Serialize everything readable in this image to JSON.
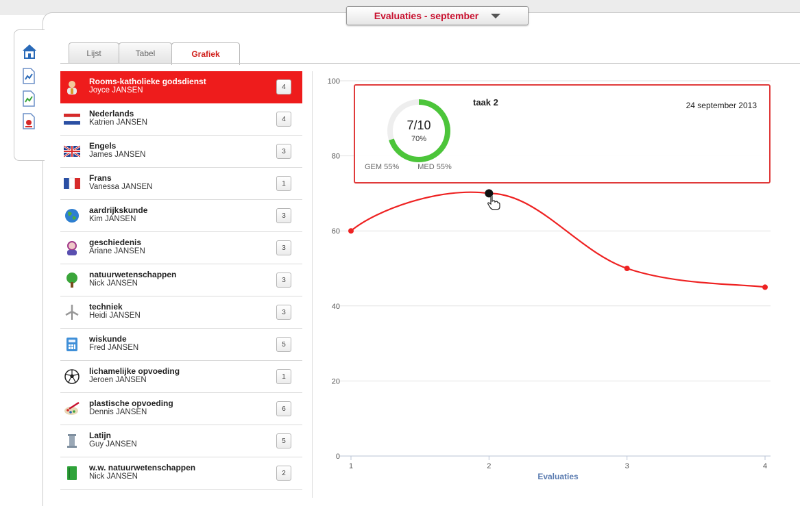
{
  "header": {
    "title": "Evaluaties - september"
  },
  "side_nav": {
    "items": [
      "home-icon",
      "document-chart-icon",
      "document-chart-green-icon",
      "document-report-icon"
    ]
  },
  "tabs": [
    {
      "label": "Lijst",
      "active": false
    },
    {
      "label": "Tabel",
      "active": false
    },
    {
      "label": "Grafiek",
      "active": true
    }
  ],
  "subjects": [
    {
      "name": "Rooms-katholieke godsdienst",
      "teacher": "Joyce JANSEN",
      "count": "4",
      "icon": "religion-icon",
      "active": true
    },
    {
      "name": "Nederlands",
      "teacher": "Katrien JANSEN",
      "count": "4",
      "icon": "dutch-flag-icon"
    },
    {
      "name": "Engels",
      "teacher": "James JANSEN",
      "count": "3",
      "icon": "uk-flag-icon"
    },
    {
      "name": "Frans",
      "teacher": "Vanessa JANSEN",
      "count": "1",
      "icon": "french-flag-icon"
    },
    {
      "name": "aardrijkskunde",
      "teacher": "Kim JANSEN",
      "count": "3",
      "icon": "globe-icon"
    },
    {
      "name": "geschiedenis",
      "teacher": "Ariane JANSEN",
      "count": "3",
      "icon": "history-icon"
    },
    {
      "name": "natuurwetenschappen",
      "teacher": "Nick JANSEN",
      "count": "3",
      "icon": "tree-icon"
    },
    {
      "name": "techniek",
      "teacher": "Heidi JANSEN",
      "count": "3",
      "icon": "windmill-icon"
    },
    {
      "name": "wiskunde",
      "teacher": "Fred JANSEN",
      "count": "5",
      "icon": "calculator-icon"
    },
    {
      "name": "lichamelijke opvoeding",
      "teacher": "Jeroen JANSEN",
      "count": "1",
      "icon": "football-icon"
    },
    {
      "name": "plastische opvoeding",
      "teacher": "Dennis JANSEN",
      "count": "6",
      "icon": "paint-icon"
    },
    {
      "name": "Latijn",
      "teacher": "Guy JANSEN",
      "count": "5",
      "icon": "column-icon"
    },
    {
      "name": "w.w. natuurwetenschappen",
      "teacher": "Nick JANSEN",
      "count": "2",
      "icon": "book-icon"
    }
  ],
  "tooltip": {
    "task": "taak 2",
    "date": "24 september 2013",
    "score": "7/10",
    "percent": "70%",
    "percent_value": 70,
    "gem": "GEM 55%",
    "med": "MED 55%"
  },
  "chart_data": {
    "type": "line",
    "x": [
      1,
      2,
      3,
      4
    ],
    "series": [
      {
        "values": [
          60,
          70,
          50,
          45
        ],
        "color": "#ee2222"
      }
    ],
    "xlabel": "Evaluaties",
    "ylabel": "",
    "ylim": [
      0,
      100
    ],
    "yticks": [
      0,
      20,
      40,
      60,
      80,
      100
    ],
    "xticks": [
      "1",
      "2",
      "3",
      "4"
    ],
    "grid": true,
    "highlighted_point": 2
  },
  "colors": {
    "accent": "#ee1c1c",
    "ring": "#4cc53a",
    "axis_title": "#5a7bb0"
  }
}
